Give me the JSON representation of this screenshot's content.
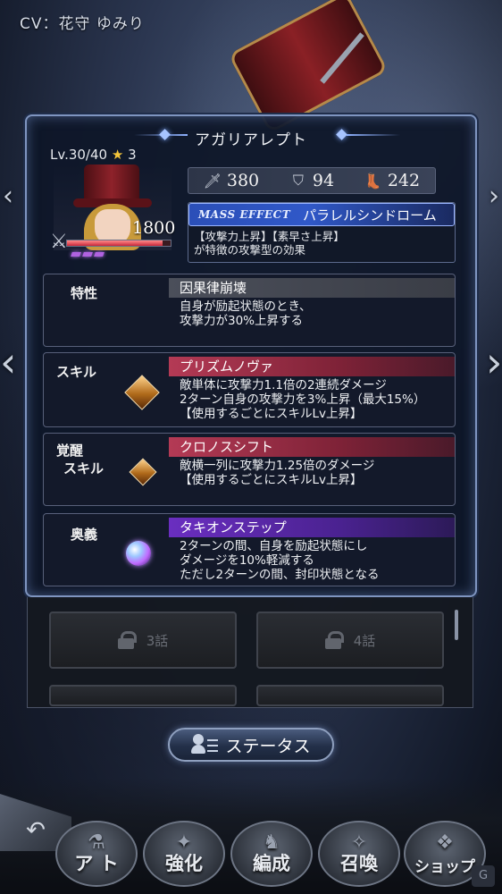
{
  "header": {
    "cv": "CV：花守 ゆみり"
  },
  "unit": {
    "name": "アガリアレプト",
    "level": "Lv.30/40",
    "stars": "3",
    "hp": "1800",
    "hp_fraction": 0.92,
    "stats": {
      "attack": "380",
      "defense": "94",
      "speed": "242"
    },
    "mass_effect": {
      "tag": "MASS EFFECT",
      "name": "パラレルシンドローム",
      "desc_line1": "【攻撃力上昇】【素早さ上昇】",
      "desc_line2": "が特徴の攻撃型の効果"
    }
  },
  "trait": {
    "label": "特性",
    "name": "因果律崩壊",
    "lines": [
      "自身が励起状態のとき、",
      "攻撃力が30%上昇する"
    ]
  },
  "skill": {
    "label": "スキル",
    "name": "プリズムノヴァ",
    "lines": [
      "敵単体に攻撃力1.1倍の2連続ダメージ",
      "2ターン自身の攻撃力を3%上昇（最大15%）",
      "【使用するごとにスキルLv上昇】"
    ]
  },
  "awaken_skill": {
    "label_line1": "覚醒",
    "label_line2": "スキル",
    "name": "クロノスシフト",
    "lines": [
      "敵横一列に攻撃力1.25倍のダメージ",
      "【使用するごとにスキルLv上昇】"
    ]
  },
  "ougi": {
    "label": "奥義",
    "name": "タキオンステップ",
    "lines": [
      "2ターンの間、自身を励起状態にし",
      "ダメージを10%軽減する",
      "ただし2ターンの間、封印状態となる"
    ]
  },
  "story": {
    "ep3": "3話",
    "ep4": "4話"
  },
  "status_button": "ステータス",
  "nav": {
    "item1": "アイテム",
    "item1_short": "ア  ト",
    "enhance": "強化",
    "formation": "編成",
    "summon": "召喚",
    "shop": "ショップ"
  },
  "colors": {
    "accent": "#8fb2ff",
    "skill_red": "#b43a55",
    "ougi_purple": "#6a2ec0"
  }
}
